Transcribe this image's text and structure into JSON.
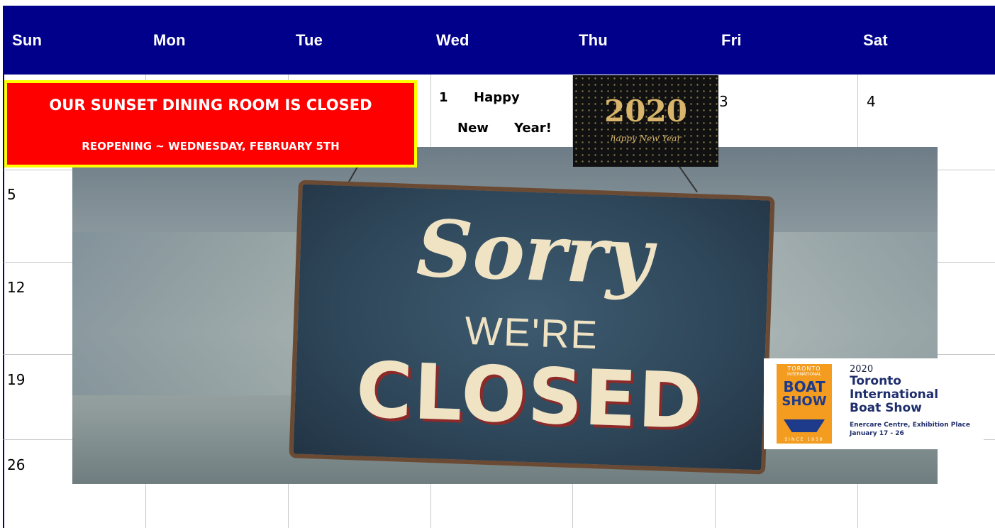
{
  "weekdays": [
    "Sun",
    "Mon",
    "Tue",
    "Wed",
    "Thu",
    "Fri",
    "Sat"
  ],
  "days": {
    "d1": "1",
    "d3": "3",
    "d4": "4",
    "d5": "5",
    "d12": "12",
    "d19": "19",
    "d26": "26"
  },
  "new_year_note": {
    "line1": "Happy",
    "line2a": "New",
    "line2b": "Year!"
  },
  "banner": {
    "headline": "OUR SUNSET DINING ROOM IS CLOSED",
    "subline": "REOPENING ~ WEDNESDAY, FEBRUARY 5TH"
  },
  "closed_sign": {
    "word1": "Sorry",
    "word2": "WE'RE",
    "word3": "CLOSED"
  },
  "new_year_image": {
    "year": "2020",
    "caption": "happy New Year"
  },
  "boat_show": {
    "logo_top": "TORONTO",
    "logo_sub": "INTERNATIONAL",
    "logo_word1": "BOAT",
    "logo_word2": "SHOW",
    "logo_since": "SINCE 1958",
    "year": "2020",
    "name1": "Toronto",
    "name2": "International",
    "name3": "Boat Show",
    "venue": "Enercare Centre, Exhibition Place",
    "dates": "January 17 - 26"
  },
  "colors": {
    "header": "#00008b",
    "banner_bg": "#ff0000",
    "banner_border": "#ffff00"
  }
}
